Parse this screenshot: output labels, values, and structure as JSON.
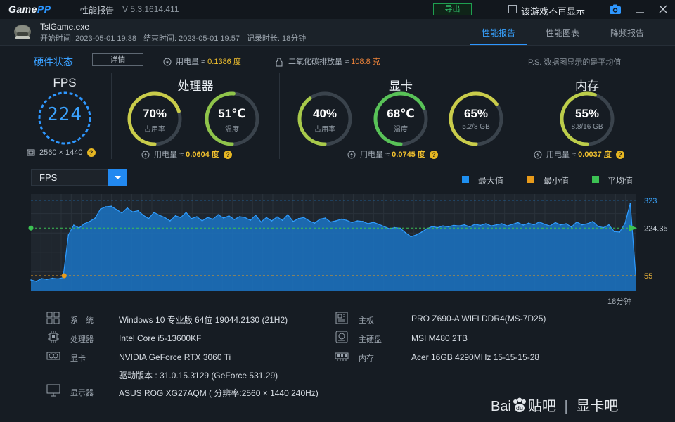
{
  "titlebar": {
    "logo_a": "Game",
    "logo_b": "PP",
    "title": "性能报告",
    "version": "V 5.3.1614.411",
    "export_label": "导出",
    "dont_show_label": "该游戏不再显示"
  },
  "game": {
    "name": "TslGame.exe",
    "start": "开始时间: 2023-05-01 19:38",
    "end": "结束时间: 2023-05-01 19:57",
    "duration": "记录时长: 18分钟"
  },
  "tabs": [
    "性能报告",
    "性能图表",
    "降频报告"
  ],
  "status": {
    "title": "硬件状态",
    "detail_label": "详情",
    "power_prefix": "用电量 ≈ ",
    "power_value": "0.1386 度",
    "co2_prefix": "二氧化碳排放量 ≈ ",
    "co2_value": "108.8 克",
    "note": "P.S. 数据图显示的是平均值"
  },
  "fps": {
    "title": "FPS",
    "value": "224",
    "resolution": "2560 × 1440"
  },
  "cpu": {
    "title": "处理器",
    "usage": {
      "value": "70%",
      "label": "占用率",
      "fraction": 0.7
    },
    "temp": {
      "value": "51℃",
      "label": "温度",
      "fraction": 0.51
    },
    "power_prefix": "用电量 ≈ ",
    "power_value": "0.0604 度"
  },
  "gpu": {
    "title": "显卡",
    "usage": {
      "value": "40%",
      "label": "占用率",
      "fraction": 0.4
    },
    "temp": {
      "value": "68℃",
      "label": "温度",
      "fraction": 0.68
    },
    "vram": {
      "value": "65%",
      "label": "5.2/8 GB",
      "fraction": 0.65
    },
    "power_prefix": "用电量 ≈ ",
    "power_value": "0.0745 度"
  },
  "memory": {
    "title": "内存",
    "usage": {
      "value": "55%",
      "label": "8.8/16 GB",
      "fraction": 0.55
    },
    "power_prefix": "用电量 ≈ ",
    "power_value": "0.0037 度"
  },
  "chart_controls": {
    "metric": "FPS",
    "legend": [
      "最大值",
      "最小值",
      "平均值"
    ],
    "duration_label": "18分钟"
  },
  "colors": {
    "accent": "#2e97ff",
    "max": "#1e8ff0",
    "min": "#e89b1b",
    "avg": "#3cc153",
    "ring_track": "#3a434c",
    "ring_cpu_usage": "#c9cc4a",
    "ring_cpu_temp": "#8fc44a",
    "ring_gpu_usage": "#a8c94a",
    "ring_gpu_temp": "#58c257",
    "ring_gpu_vram": "#c9cc4a",
    "ring_mem": "#bccd4a"
  },
  "chart_data": {
    "type": "area",
    "x_unit": "min",
    "xlim": [
      0,
      18
    ],
    "ylim": [
      0,
      345
    ],
    "ref_lines": [
      {
        "label": "323",
        "value": 323,
        "kind": "max"
      },
      {
        "label": "224.35",
        "value": 224.35,
        "kind": "avg"
      },
      {
        "label": "55",
        "value": 55,
        "kind": "min"
      }
    ],
    "series": [
      {
        "values": [
          40,
          35,
          45,
          42,
          46,
          44,
          48,
          200,
          235,
          225,
          240,
          248,
          260,
          292,
          300,
          302,
          290,
          278,
          296,
          282,
          286,
          270,
          258,
          280,
          270,
          262,
          250,
          268,
          262,
          280,
          258,
          265,
          250,
          262,
          256,
          272,
          260,
          268,
          255,
          265,
          262,
          252,
          270,
          246,
          262,
          250,
          264,
          252,
          272,
          248,
          258,
          262,
          250,
          242,
          256,
          260,
          246,
          250,
          256,
          252,
          244,
          250,
          248,
          240,
          245,
          238,
          230,
          222,
          226,
          224,
          208,
          194,
          200,
          210,
          222,
          230,
          226,
          232,
          229,
          234,
          232,
          236,
          229,
          238,
          234,
          240,
          232,
          236,
          240,
          232,
          238,
          244,
          235,
          242,
          236,
          246,
          238,
          232,
          244,
          236,
          240,
          228,
          246,
          236,
          240,
          248,
          230,
          226,
          236,
          212,
          210,
          240,
          312,
          60
        ]
      }
    ]
  },
  "system": {
    "os_label": "系　统",
    "os_value": "Windows 10 专业版 64位 19044.2130 (21H2)",
    "cpu_label": "处理器",
    "cpu_value": "Intel Core i5-13600KF",
    "gpu_label": "显卡",
    "gpu_value": "NVIDIA GeForce RTX 3060 Ti",
    "driver_value": "驱动版本 : 31.0.15.3129 (GeForce 531.29)",
    "monitor_label": "显示器",
    "monitor_value": "ASUS ROG XG27AQM ( 分辨率:2560 × 1440 240Hz)",
    "board_label": "主板",
    "board_value": "PRO Z690-A WIFI DDR4(MS-7D25)",
    "disk_label": "主硬盘",
    "disk_value": "MSI M480 2TB",
    "mem_label": "内存",
    "mem_value": "Acer 16GB 4290MHz 15-15-15-28"
  },
  "watermark": {
    "brand_a": "Bai",
    "brand_b": "贴吧",
    "forum": "显卡吧"
  }
}
